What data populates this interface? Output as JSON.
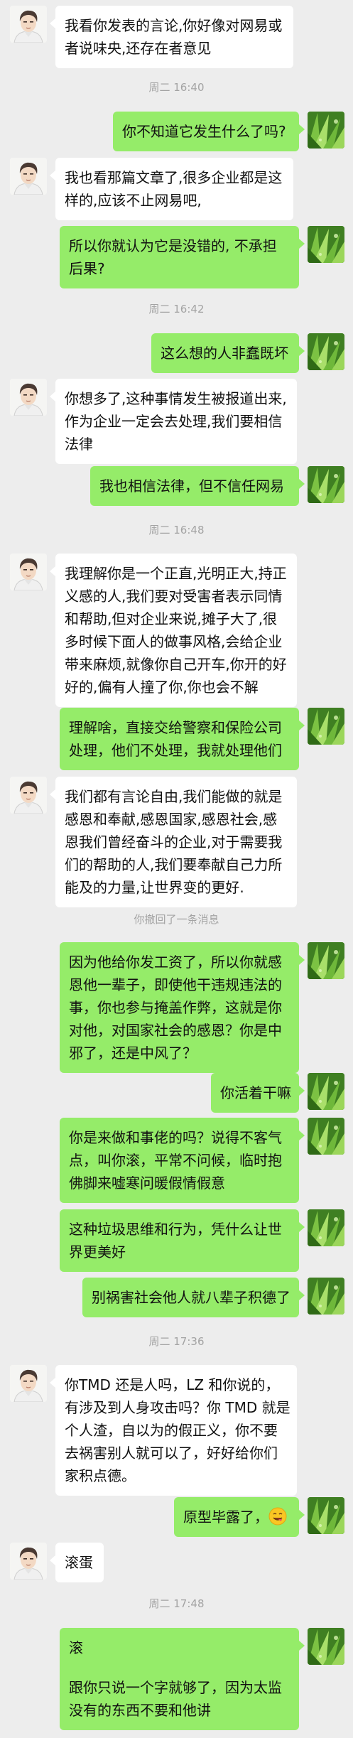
{
  "messages": [
    {
      "kind": "in",
      "lines": [
        "我看你发表的言论,你好像对网易或",
        "者说味央,还存在者意见"
      ]
    },
    {
      "kind": "time",
      "text": "周二 16:40"
    },
    {
      "kind": "out",
      "lines": [
        "你不知道它发生什么了吗?"
      ]
    },
    {
      "kind": "in",
      "lines": [
        "我也看那篇文章了,很多企业都是这",
        "样的,应该不止网易吧,"
      ]
    },
    {
      "kind": "out",
      "lines": [
        "所以你就认为它是没错的, 不承担",
        "后果?"
      ]
    },
    {
      "kind": "time",
      "text": "周二 16:42"
    },
    {
      "kind": "out",
      "lines": [
        "这么想的人非蠢既坏"
      ]
    },
    {
      "kind": "in",
      "lines": [
        "你想多了,这种事情发生被报道出来,",
        "作为企业一定会去处理,我们要相信",
        "法律"
      ]
    },
    {
      "kind": "out",
      "lines": [
        "我也相信法律，但不信任网易"
      ]
    },
    {
      "kind": "time",
      "text": "周二 16:48"
    },
    {
      "kind": "in",
      "lines": [
        "我理解你是一个正直,光明正大,持正",
        "义感的人,我们要对受害者表示同情",
        "和帮助,但对企业来说,摊子大了,很",
        "多时候下面人的做事风格,会给企业",
        "带来麻烦,就像你自己开车,你开的好",
        "好的,偏有人撞了你,你也会不解"
      ]
    },
    {
      "kind": "out",
      "lines": [
        "理解啥，直接交给警察和保险公司",
        "处理，他们不处理，我就处理他们"
      ]
    },
    {
      "kind": "in",
      "lines": [
        "我们都有言论自由,我们能做的就是",
        "感恩和奉献,感恩国家,感恩社会,感",
        "恩我们曾经奋斗的企业,对于需要我",
        "们的帮助的人,我们要奉献自己力所",
        "能及的力量,让世界变的更好."
      ]
    },
    {
      "kind": "time",
      "text": "你撤回了一条消息"
    },
    {
      "kind": "out",
      "lines": [
        "因为他给你发工资了，所以你就感",
        "恩他一辈子，即使他干违规违法的",
        "事，你也参与掩盖作弊，这就是你",
        "对他，对国家社会的感恩？你是中",
        "邪了，还是中风了？"
      ]
    },
    {
      "kind": "out",
      "lines": [
        "你活着干嘛"
      ]
    },
    {
      "kind": "out",
      "lines": [
        "你是来做和事佬的吗？说得不客气",
        "点，叫你滚，平常不问候，临时抱",
        "佛脚来嘘寒问暖假情假意"
      ]
    },
    {
      "kind": "out",
      "lines": [
        "这种垃圾思维和行为，凭什么让世",
        "界更美好"
      ]
    },
    {
      "kind": "out",
      "lines": [
        "别祸害社会他人就八辈子积德了"
      ]
    },
    {
      "kind": "time",
      "text": "周二 17:36"
    },
    {
      "kind": "in",
      "lines": [
        "你TMD 还是人吗，LZ 和你说的，",
        "有涉及到人身攻击吗？你 TMD 就是",
        "个人渣，自以为的假正义，你不要",
        "去祸害别人就可以了，好好给你们",
        "家积点德。"
      ]
    },
    {
      "kind": "out",
      "lines": [
        "原型毕露了，"
      ],
      "emoji": true
    },
    {
      "kind": "in",
      "lines": [
        "滚蛋"
      ]
    },
    {
      "kind": "time",
      "text": "周二 17:48"
    },
    {
      "kind": "out",
      "lines": [
        "滚",
        "",
        "跟你只说一个字就够了，因为太监",
        "没有的东西不要和他讲"
      ]
    }
  ]
}
